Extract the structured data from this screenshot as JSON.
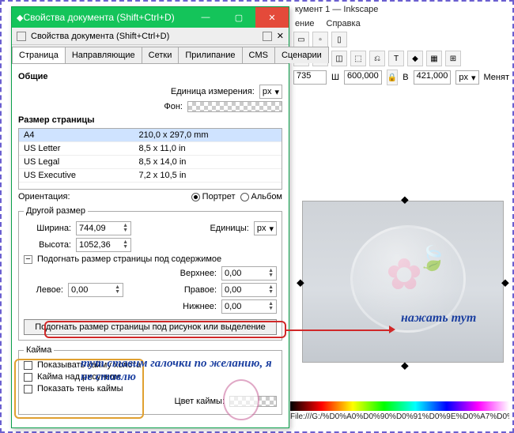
{
  "inkscape": {
    "title": "кумент 1 — Inkscape",
    "menu": {
      "edit": "ение",
      "help": "Справка"
    },
    "coords": {
      "x_value": "735",
      "w_label": "Ш",
      "w_value": "600,000",
      "h_label": "В",
      "h_value": "421,000",
      "unit": "px",
      "swap": "Менят"
    },
    "status": "File:///G:/%D0%A0%D0%90%D0%91%D0%9E%D0%A7%D0%",
    "note_press": "нажать тут"
  },
  "dialog": {
    "title": "Свойства документа (Shift+Ctrl+D)",
    "subtitle": "Свойства документа (Shift+Ctrl+D)",
    "tabs": {
      "page": "Страница",
      "guides": "Направляющие",
      "grids": "Сетки",
      "snap": "Прилипание",
      "cms": "CMS",
      "scripts": "Сценарии"
    },
    "general": "Общие",
    "unit_label": "Единица измерения:",
    "unit_value": "px",
    "bg_label": "Фон:",
    "pagesize_title": "Размер страницы",
    "sizes": [
      {
        "name": "A4",
        "dim": "210,0 x 297,0 mm"
      },
      {
        "name": "US Letter",
        "dim": "8,5 x 11,0 in"
      },
      {
        "name": "US Legal",
        "dim": "8,5 x 14,0 in"
      },
      {
        "name": "US Executive",
        "dim": "7,2 x 10,5 in"
      }
    ],
    "orient_label": "Ориентация:",
    "orient_portrait": "Портрет",
    "orient_landscape": "Альбом",
    "custom_legend": "Другой размер",
    "width_label": "Ширина:",
    "width_value": "744,09",
    "height_label": "Высота:",
    "height_value": "1052,36",
    "units_label": "Единицы:",
    "units_value": "px",
    "fit_toggle": "Подогнать размер страницы под содержимое",
    "margins": {
      "top_label": "Верхнее:",
      "bottom_label": "Нижнее:",
      "left_label": "Левое:",
      "right_label": "Правое:",
      "value": "0,00"
    },
    "fit_button": "Подогнать размер страницы под рисунок или выделение",
    "border_legend": "Кайма",
    "border_opts": {
      "show": "Показывать кайму холста",
      "above": "Кайма над рисунком",
      "shadow": "Показать тень каймы"
    },
    "border_color_label": "Цвет каймы:"
  },
  "notes": {
    "checks": "тут ставим галочки по желанию, я не ставлю"
  }
}
